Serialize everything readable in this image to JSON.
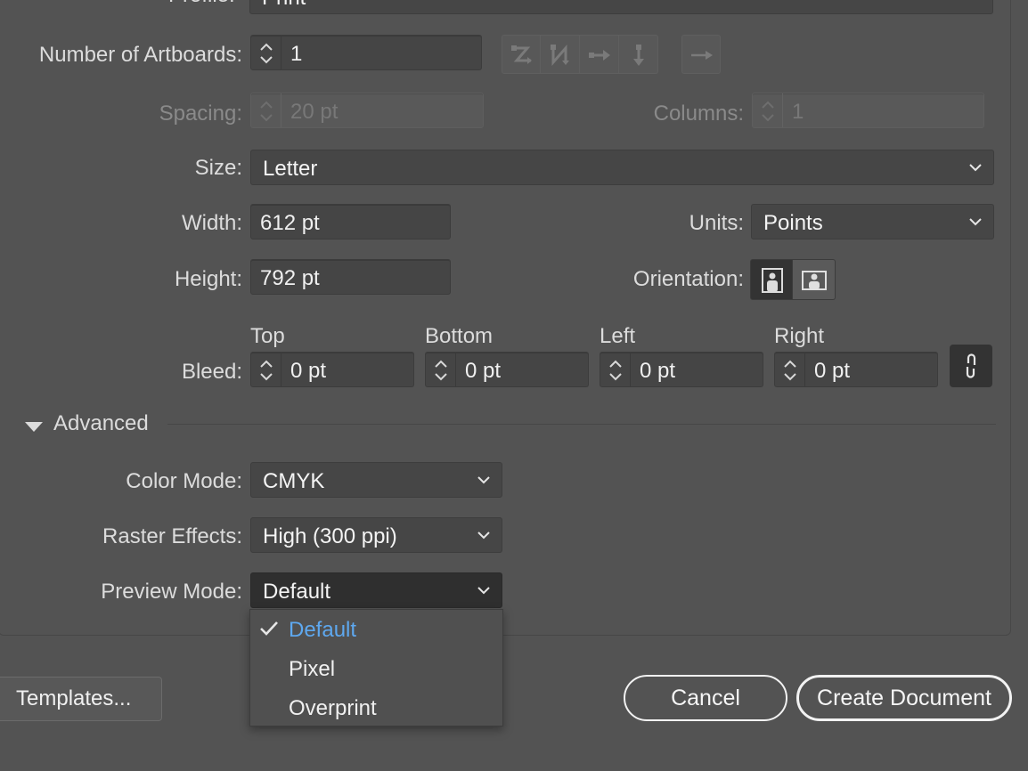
{
  "profile": {
    "label": "Profile:",
    "value": "Print"
  },
  "artboards": {
    "label": "Number of Artboards:",
    "value": "1",
    "layout_icons": [
      "grid-by-row-icon",
      "grid-by-column-icon",
      "arrange-by-row-icon",
      "arrange-by-column-icon",
      "right-to-left-icon"
    ]
  },
  "spacing": {
    "label": "Spacing:",
    "value": "20 pt"
  },
  "columns": {
    "label": "Columns:",
    "value": "1"
  },
  "size": {
    "label": "Size:",
    "value": "Letter"
  },
  "width": {
    "label": "Width:",
    "value": "612 pt"
  },
  "height": {
    "label": "Height:",
    "value": "792 pt"
  },
  "units": {
    "label": "Units:",
    "value": "Points"
  },
  "orientation": {
    "label": "Orientation:",
    "selected": "portrait"
  },
  "bleed": {
    "label": "Bleed:",
    "top_label": "Top",
    "top": "0 pt",
    "bottom_label": "Bottom",
    "bottom": "0 pt",
    "left_label": "Left",
    "left": "0 pt",
    "right_label": "Right",
    "right": "0 pt",
    "linked": true
  },
  "advanced": {
    "label": "Advanced",
    "expanded": true,
    "color_mode": {
      "label": "Color Mode:",
      "value": "CMYK"
    },
    "raster_effects": {
      "label": "Raster Effects:",
      "value": "High (300 ppi)"
    },
    "preview_mode": {
      "label": "Preview Mode:",
      "value": "Default",
      "options": [
        "Default",
        "Pixel",
        "Overprint"
      ],
      "selected_index": 0
    }
  },
  "buttons": {
    "templates": "Templates...",
    "cancel": "Cancel",
    "create": "Create Document"
  },
  "colors": {
    "selected_option": "#5ea8ef",
    "background": "#535353"
  }
}
